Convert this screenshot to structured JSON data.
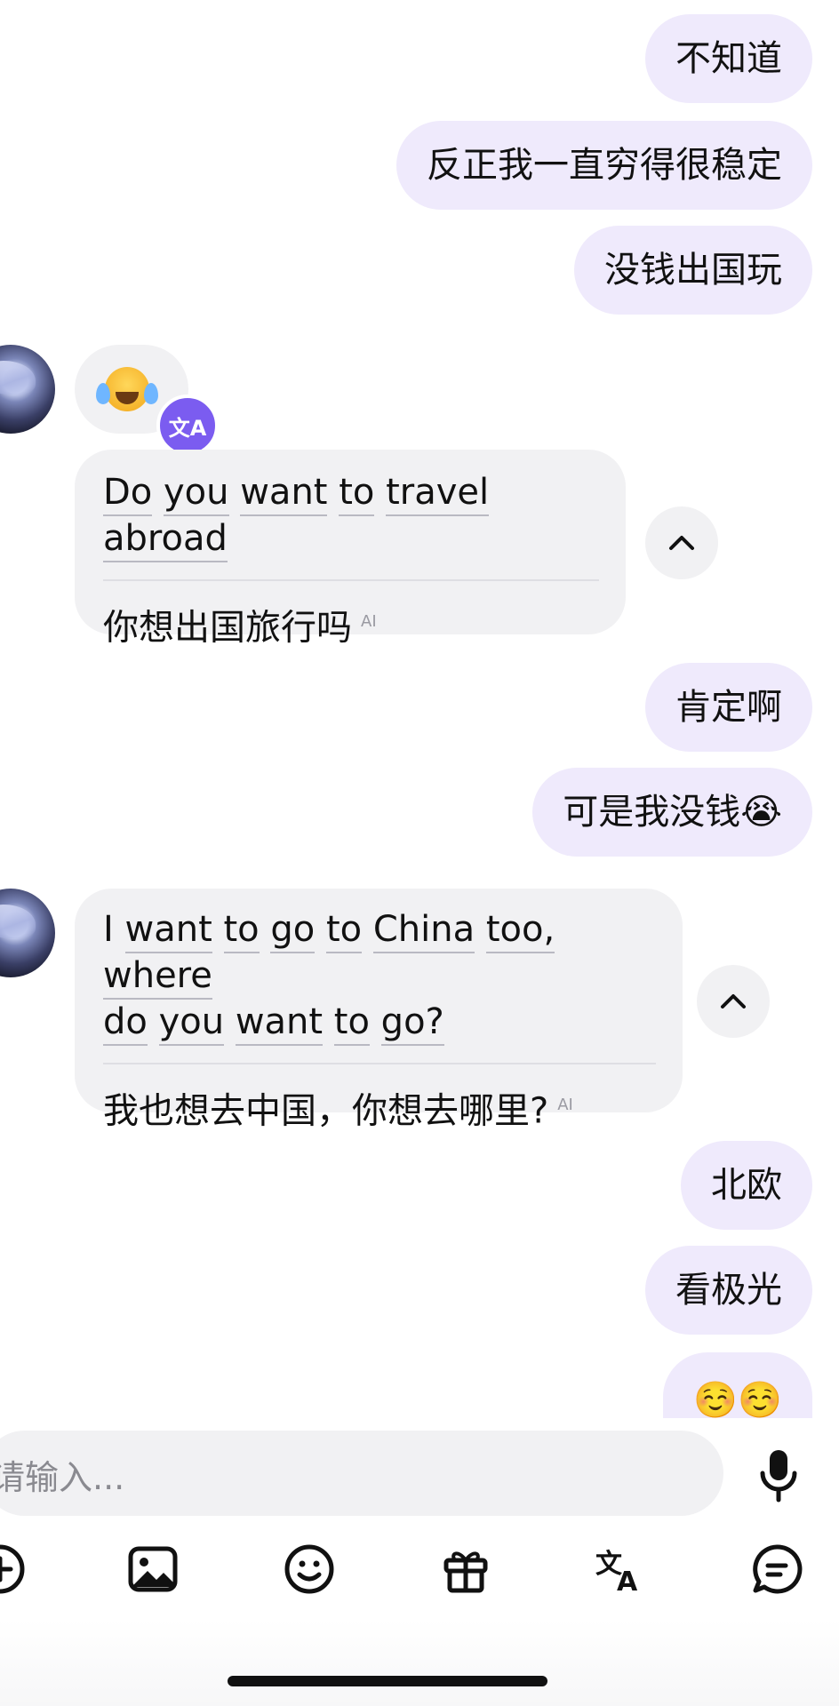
{
  "messages": {
    "out1": "不知道",
    "out2": "反正我一直穷得很稳定",
    "out3": "没钱出国玩",
    "in_emoji": "😂",
    "in1": {
      "words": [
        "Do",
        "you",
        "want",
        "to",
        "travel",
        "abroad"
      ],
      "translation": "你想出国旅行吗",
      "ai_label": "AI"
    },
    "out4": "肯定啊",
    "out5": "可是我没钱😭",
    "in2": {
      "line1": [
        "I",
        "want",
        "to",
        "go",
        "to",
        "China",
        "too,",
        "where"
      ],
      "line2": [
        "do",
        "you",
        "want",
        "to",
        "go?"
      ],
      "translation": "我也想去中国，你想去哪里?",
      "ai_label": "AI"
    },
    "out6": "北欧",
    "out7": "看极光",
    "out8": "☺️☺️"
  },
  "badge": {
    "icon": "translate-icon",
    "text": "文A"
  },
  "input": {
    "placeholder": "请输入..."
  },
  "toolbar": {
    "icons": [
      "add-icon",
      "image-icon",
      "emoji-icon",
      "gift-icon",
      "translate-icon",
      "chat-icon"
    ],
    "colors": {
      "accent": "#7b5cf0",
      "bubble_out": "#efeafc",
      "bubble_in": "#f1f1f3"
    }
  }
}
